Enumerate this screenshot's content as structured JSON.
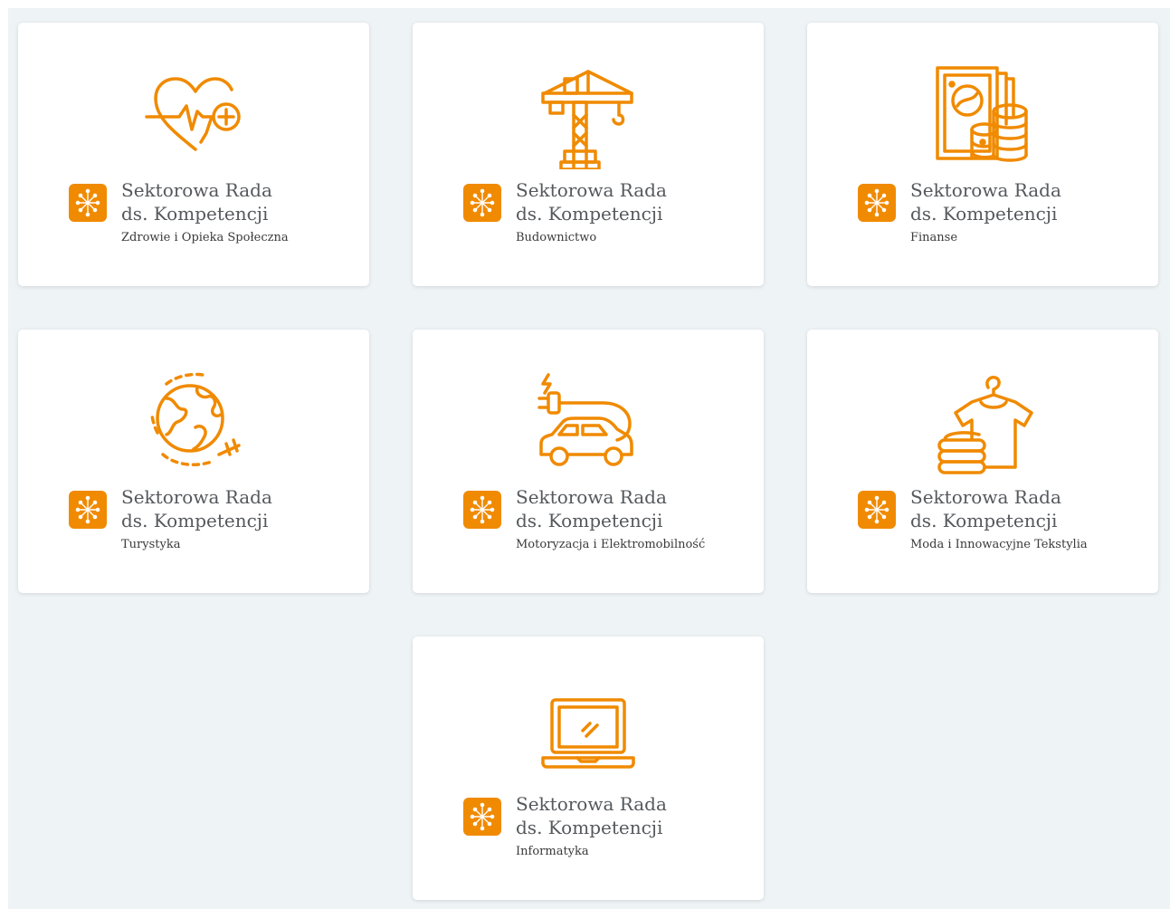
{
  "colors": {
    "accent": "#f08a00",
    "background": "#eef3f6",
    "card": "#ffffff",
    "text": "#55585c"
  },
  "cards": [
    {
      "title_line1": "Sektorowa Rada",
      "title_line2": "ds. Kompetencji",
      "sector": "Zdrowie i Opieka Społeczna",
      "icon": "heart-health-icon"
    },
    {
      "title_line1": "Sektorowa Rada",
      "title_line2": "ds. Kompetencji",
      "sector": "Budownictwo",
      "icon": "crane-icon"
    },
    {
      "title_line1": "Sektorowa Rada",
      "title_line2": "ds. Kompetencji",
      "sector": "Finanse",
      "icon": "money-coins-icon"
    },
    {
      "title_line1": "Sektorowa Rada",
      "title_line2": "ds. Kompetencji",
      "sector": "Turystyka",
      "icon": "globe-plane-icon"
    },
    {
      "title_line1": "Sektorowa Rada",
      "title_line2": "ds. Kompetencji",
      "sector": "Motoryzacja i Elektromobilność",
      "icon": "electric-car-icon"
    },
    {
      "title_line1": "Sektorowa Rada",
      "title_line2": "ds. Kompetencji",
      "sector": "Moda i Innowacyjne Tekstylia",
      "icon": "clothing-icon"
    },
    {
      "title_line1": "Sektorowa Rada",
      "title_line2": "ds. Kompetencji",
      "sector": "Informatyka",
      "icon": "laptop-icon"
    }
  ]
}
